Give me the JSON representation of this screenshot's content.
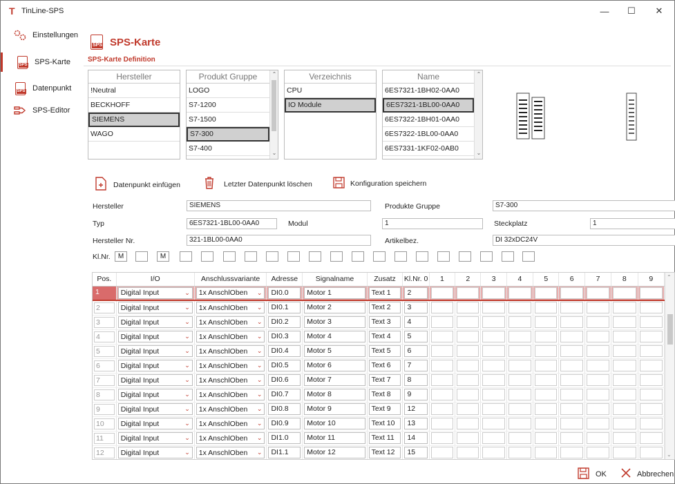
{
  "window": {
    "title": "TinLine-SPS",
    "logo": "T",
    "minimize": "—",
    "maximize": "☐",
    "close": "✕"
  },
  "sidebar": {
    "items": [
      {
        "label": "Einstellungen",
        "icon": "gears-icon"
      },
      {
        "label": "SPS-Karte",
        "icon": "sps-icon",
        "active": true
      },
      {
        "label": "Datenpunkt",
        "icon": "sps-icon"
      },
      {
        "label": "SPS-Editor",
        "icon": "network-icon"
      }
    ]
  },
  "header": {
    "title": "SPS-Karte",
    "icon_text": "SPS"
  },
  "definition": {
    "title": "SPS-Karte Definition"
  },
  "lists": {
    "hersteller": {
      "header": "Hersteller",
      "items": [
        "!Neutral",
        "BECKHOFF",
        "SIEMENS",
        "WAGO"
      ],
      "selected": 2
    },
    "produkt": {
      "header": "Produkt Gruppe",
      "items": [
        "LOGO",
        "S7-1200",
        "S7-1500",
        "S7-300",
        "S7-400"
      ],
      "selected": 3
    },
    "verzeichnis": {
      "header": "Verzeichnis",
      "items": [
        "CPU",
        "IO Module"
      ],
      "selected": 1
    },
    "name": {
      "header": "Name",
      "items": [
        "6ES7321-1BH02-0AA0",
        "6ES7321-1BL00-0AA0",
        "6ES7322-1BH01-0AA0",
        "6ES7322-1BL00-0AA0",
        "6ES7331-1KF02-0AB0"
      ],
      "selected": 1
    }
  },
  "actions": {
    "insert": "Datenpunkt einfügen",
    "delete": "Letzter Datenpunkt löschen",
    "save": "Konfiguration speichern"
  },
  "fields": {
    "hersteller_label": "Hersteller",
    "hersteller_value": "SIEMENS",
    "produkte_gruppe_label": "Produkte Gruppe",
    "produkte_gruppe_value": "S7-300",
    "typ_label": "Typ",
    "typ_value": "6ES7321-1BL00-0AA0",
    "modul_label": "Modul",
    "modul_value": "1",
    "steckplatz_label": "Steckplatz",
    "steckplatz_value": "1",
    "herst_nr_label": "Hersteller Nr.",
    "herst_nr_value": "321-1BL00-0AA0",
    "artikel_label": "Artikelbez.",
    "artikel_value": "DI 32xDC24V",
    "klnr_label": "Kl.Nr.",
    "klnr_values": [
      "M",
      "",
      "M",
      "",
      "",
      "",
      "",
      "",
      "",
      "",
      "",
      "",
      "",
      "",
      "",
      "",
      "",
      "",
      "",
      ""
    ]
  },
  "grid": {
    "headers": [
      "Pos.",
      "I/O",
      "Anschlussvariante",
      "Adresse",
      "Signalname",
      "Zusatz",
      "Kl.Nr. 0",
      "1",
      "2",
      "3",
      "4",
      "5",
      "6",
      "7",
      "8",
      "9"
    ],
    "rows": [
      [
        "1",
        "Digital Input",
        "1x AnschlOben",
        "DI0.0",
        "Motor 1",
        "Text 1",
        "2"
      ],
      [
        "2",
        "Digital Input",
        "1x AnschlOben",
        "DI0.1",
        "Motor 2",
        "Text 2",
        "3"
      ],
      [
        "3",
        "Digital Input",
        "1x AnschlOben",
        "DI0.2",
        "Motor 3",
        "Text 3",
        "4"
      ],
      [
        "4",
        "Digital Input",
        "1x AnschlOben",
        "DI0.3",
        "Motor 4",
        "Text 4",
        "5"
      ],
      [
        "5",
        "Digital Input",
        "1x AnschlOben",
        "DI0.4",
        "Motor 5",
        "Text 5",
        "6"
      ],
      [
        "6",
        "Digital Input",
        "1x AnschlOben",
        "DI0.5",
        "Motor 6",
        "Text 6",
        "7"
      ],
      [
        "7",
        "Digital Input",
        "1x AnschlOben",
        "DI0.6",
        "Motor 7",
        "Text 7",
        "8"
      ],
      [
        "8",
        "Digital Input",
        "1x AnschlOben",
        "DI0.7",
        "Motor 8",
        "Text 8",
        "9"
      ],
      [
        "9",
        "Digital Input",
        "1x AnschlOben",
        "DI0.8",
        "Motor 9",
        "Text 9",
        "12"
      ],
      [
        "10",
        "Digital Input",
        "1x AnschlOben",
        "DI0.9",
        "Motor 10",
        "Text 10",
        "13"
      ],
      [
        "11",
        "Digital Input",
        "1x AnschlOben",
        "DI1.0",
        "Motor 11",
        "Text 11",
        "14"
      ],
      [
        "12",
        "Digital Input",
        "1x AnschlOben",
        "DI1.1",
        "Motor 12",
        "Text 12",
        "15"
      ]
    ],
    "selected_row": 0
  },
  "footer": {
    "ok": "OK",
    "cancel": "Abbrechen"
  },
  "colors": {
    "accent": "#c0392b",
    "selected_row": "#e8aeae"
  }
}
